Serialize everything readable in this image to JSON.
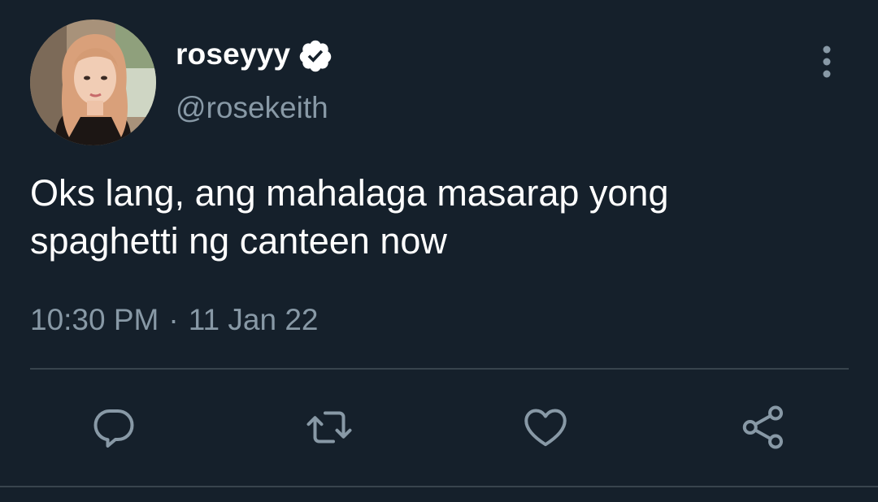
{
  "tweet": {
    "display_name": "roseyyy",
    "handle": "@rosekeith",
    "text_line1": "Oks lang, ang mahalaga masarap yong",
    "text_line2": "spaghetti ng canteen now",
    "time": "10:30 PM",
    "separator": "·",
    "date": "11 Jan 22"
  },
  "icons": {
    "verified": "verified-badge-icon",
    "more": "more-vertical-icon",
    "reply": "reply-icon",
    "retweet": "retweet-icon",
    "like": "like-icon",
    "share": "share-icon"
  },
  "colors": {
    "background": "#15202b",
    "text": "#ffffff",
    "secondary_text": "#8899a6",
    "divider": "#38444d"
  }
}
